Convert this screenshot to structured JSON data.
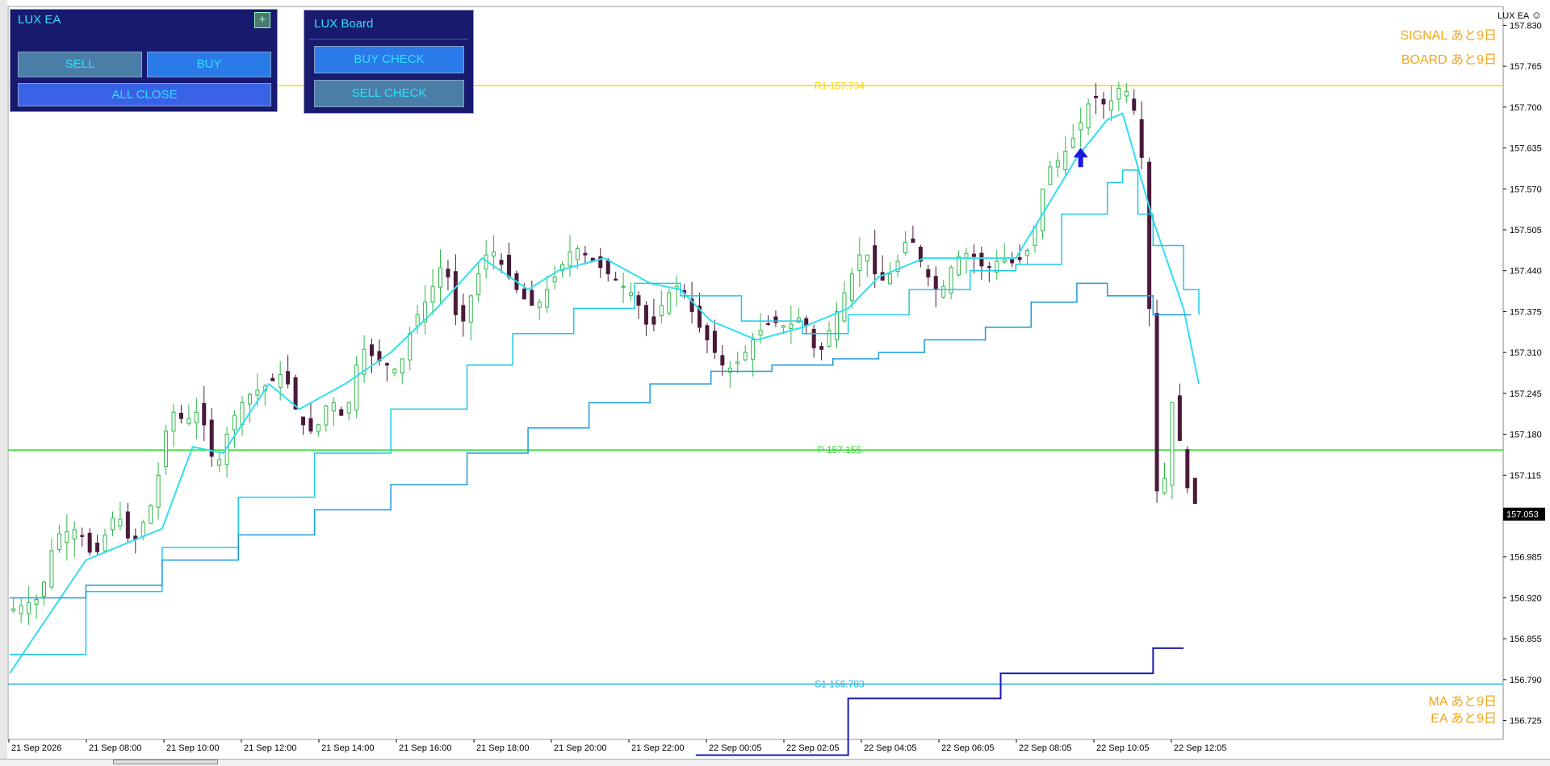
{
  "ea_panel": {
    "title": "LUX EA",
    "plus_label": "+",
    "sell_label": "SELL",
    "buy_label": "BUY",
    "close_label": "ALL CLOSE"
  },
  "board_panel": {
    "title": "LUX Board",
    "buy_check_label": "BUY CHECK",
    "sell_check_label": "SELL CHECK"
  },
  "indicator_label": "LUX EA",
  "smiley_icon": "smiley-icon",
  "overlays": {
    "signal": "SIGNAL あと9日",
    "board": "BOARD あと9日",
    "ma": "MA あと9日",
    "ea": "EA あと9日"
  },
  "colors": {
    "signal_text": "#f2a51a",
    "ma_fast": "#2fe0f0",
    "ma_slow": "#1a9ae0",
    "bull": "#2fb84a",
    "bear": "#4a1a3a",
    "r1": "#ffd400",
    "p": "#22dd22",
    "s1": "#22b8e0",
    "panel_bg": "#171a6e"
  },
  "chart_data": {
    "type": "candlestick",
    "symbol_label": "LUX EA",
    "ylim": [
      156.695,
      157.86
    ],
    "y_ticks": [
      "157.830",
      "157.765",
      "157.700",
      "157.635",
      "157.570",
      "157.505",
      "157.440",
      "157.375",
      "157.310",
      "157.245",
      "157.180",
      "157.115",
      "157.053",
      "156.985",
      "156.920",
      "156.855",
      "156.790",
      "156.725"
    ],
    "current_price": "157.053",
    "x_labels": [
      "21 Sep 2026",
      "21 Sep 08:00",
      "21 Sep 10:00",
      "21 Sep 12:00",
      "21 Sep 14:00",
      "21 Sep 16:00",
      "21 Sep 18:00",
      "21 Sep 20:00",
      "21 Sep 22:00",
      "22 Sep 00:05",
      "22 Sep 02:05",
      "22 Sep 04:05",
      "22 Sep 06:05",
      "22 Sep 08:05",
      "22 Sep 10:05",
      "22 Sep 12:05"
    ],
    "levels": [
      {
        "name": "R1",
        "label": "R1 157.734",
        "value": 157.734
      },
      {
        "name": "P",
        "label": "P 157.155",
        "value": 157.155
      },
      {
        "name": "S1",
        "label": "S1 156.783",
        "value": 156.783
      }
    ],
    "close_path": [
      [
        0,
        156.9
      ],
      [
        4,
        156.92
      ],
      [
        6,
        157.02
      ],
      [
        9,
        157.03
      ],
      [
        11,
        156.98
      ],
      [
        14,
        157.06
      ],
      [
        16,
        157.0
      ],
      [
        19,
        157.08
      ],
      [
        21,
        157.22
      ],
      [
        23,
        157.2
      ],
      [
        25,
        157.22
      ],
      [
        27,
        157.12
      ],
      [
        29,
        157.2
      ],
      [
        31,
        157.24
      ],
      [
        34,
        157.26
      ],
      [
        36,
        157.28
      ],
      [
        38,
        157.2
      ],
      [
        40,
        157.18
      ],
      [
        42,
        157.24
      ],
      [
        44,
        157.2
      ],
      [
        46,
        157.32
      ],
      [
        48,
        157.3
      ],
      [
        51,
        157.28
      ],
      [
        53,
        157.36
      ],
      [
        55,
        157.4
      ],
      [
        57,
        157.46
      ],
      [
        59,
        157.34
      ],
      [
        61,
        157.42
      ],
      [
        63,
        157.48
      ],
      [
        65,
        157.44
      ],
      [
        67,
        157.4
      ],
      [
        69,
        157.38
      ],
      [
        71,
        157.42
      ],
      [
        74,
        157.48
      ],
      [
        76,
        157.46
      ],
      [
        78,
        157.44
      ],
      [
        80,
        157.42
      ],
      [
        82,
        157.4
      ],
      [
        84,
        157.34
      ],
      [
        86,
        157.4
      ],
      [
        88,
        157.42
      ],
      [
        90,
        157.36
      ],
      [
        92,
        157.32
      ],
      [
        94,
        157.28
      ],
      [
        96,
        157.3
      ],
      [
        98,
        157.34
      ],
      [
        100,
        157.36
      ],
      [
        102,
        157.35
      ],
      [
        104,
        157.37
      ],
      [
        106,
        157.3
      ],
      [
        108,
        157.36
      ],
      [
        110,
        157.42
      ],
      [
        112,
        157.48
      ],
      [
        114,
        157.42
      ],
      [
        116,
        157.44
      ],
      [
        118,
        157.5
      ],
      [
        120,
        157.44
      ],
      [
        122,
        157.4
      ],
      [
        124,
        157.46
      ],
      [
        126,
        157.47
      ],
      [
        128,
        157.44
      ],
      [
        130,
        157.46
      ],
      [
        132,
        157.45
      ],
      [
        134,
        157.48
      ],
      [
        136,
        157.6
      ],
      [
        138,
        157.62
      ],
      [
        140,
        157.66
      ],
      [
        142,
        157.72
      ],
      [
        144,
        157.7
      ],
      [
        146,
        157.74
      ],
      [
        148,
        157.68
      ],
      [
        149,
        157.56
      ],
      [
        150,
        157.2
      ],
      [
        151,
        156.98
      ],
      [
        152,
        157.24
      ],
      [
        153,
        157.22
      ],
      [
        154,
        157.12
      ],
      [
        155,
        157.07
      ]
    ],
    "ma_fast_path": [
      [
        0,
        156.8
      ],
      [
        10,
        156.98
      ],
      [
        20,
        157.03
      ],
      [
        24,
        157.16
      ],
      [
        28,
        157.15
      ],
      [
        34,
        157.26
      ],
      [
        38,
        157.22
      ],
      [
        44,
        157.26
      ],
      [
        50,
        157.31
      ],
      [
        56,
        157.38
      ],
      [
        62,
        157.46
      ],
      [
        68,
        157.41
      ],
      [
        72,
        157.44
      ],
      [
        78,
        157.46
      ],
      [
        84,
        157.42
      ],
      [
        88,
        157.41
      ],
      [
        92,
        157.36
      ],
      [
        98,
        157.33
      ],
      [
        104,
        157.35
      ],
      [
        110,
        157.38
      ],
      [
        114,
        157.43
      ],
      [
        120,
        157.46
      ],
      [
        126,
        157.46
      ],
      [
        132,
        157.46
      ],
      [
        136,
        157.54
      ],
      [
        140,
        157.62
      ],
      [
        144,
        157.68
      ],
      [
        146,
        157.69
      ],
      [
        150,
        157.52
      ],
      [
        154,
        157.38
      ],
      [
        156,
        157.26
      ]
    ],
    "ma_slow_path": [
      [
        0,
        156.83
      ],
      [
        10,
        156.93
      ],
      [
        20,
        157.0
      ],
      [
        30,
        157.08
      ],
      [
        40,
        157.15
      ],
      [
        50,
        157.22
      ],
      [
        60,
        157.29
      ],
      [
        66,
        157.34
      ],
      [
        74,
        157.38
      ],
      [
        82,
        157.42
      ],
      [
        88,
        157.4
      ],
      [
        96,
        157.36
      ],
      [
        104,
        157.34
      ],
      [
        110,
        157.37
      ],
      [
        118,
        157.41
      ],
      [
        126,
        157.44
      ],
      [
        132,
        157.45
      ],
      [
        138,
        157.53
      ],
      [
        144,
        157.58
      ],
      [
        146,
        157.6
      ],
      [
        148,
        157.53
      ],
      [
        150,
        157.48
      ],
      [
        154,
        157.41
      ],
      [
        156,
        157.37
      ]
    ],
    "blue_step_path": [
      [
        0,
        156.92
      ],
      [
        10,
        156.94
      ],
      [
        20,
        156.98
      ],
      [
        30,
        157.02
      ],
      [
        40,
        157.06
      ],
      [
        50,
        157.1
      ],
      [
        60,
        157.15
      ],
      [
        68,
        157.19
      ],
      [
        76,
        157.23
      ],
      [
        84,
        157.26
      ],
      [
        92,
        157.28
      ],
      [
        100,
        157.29
      ],
      [
        108,
        157.3
      ],
      [
        114,
        157.31
      ],
      [
        120,
        157.33
      ],
      [
        128,
        157.35
      ],
      [
        134,
        157.39
      ],
      [
        140,
        157.42
      ],
      [
        144,
        157.4
      ],
      [
        150,
        157.37
      ],
      [
        155,
        157.37
      ]
    ],
    "navy_step_path": [
      [
        90,
        156.67
      ],
      [
        110,
        156.67
      ],
      [
        110,
        156.76
      ],
      [
        130,
        156.76
      ],
      [
        130,
        156.8
      ],
      [
        150,
        156.8
      ],
      [
        150,
        156.84
      ],
      [
        154,
        156.84
      ]
    ],
    "bars": 156,
    "arrow": {
      "x": 140,
      "price": 157.62,
      "direction": "up"
    }
  }
}
